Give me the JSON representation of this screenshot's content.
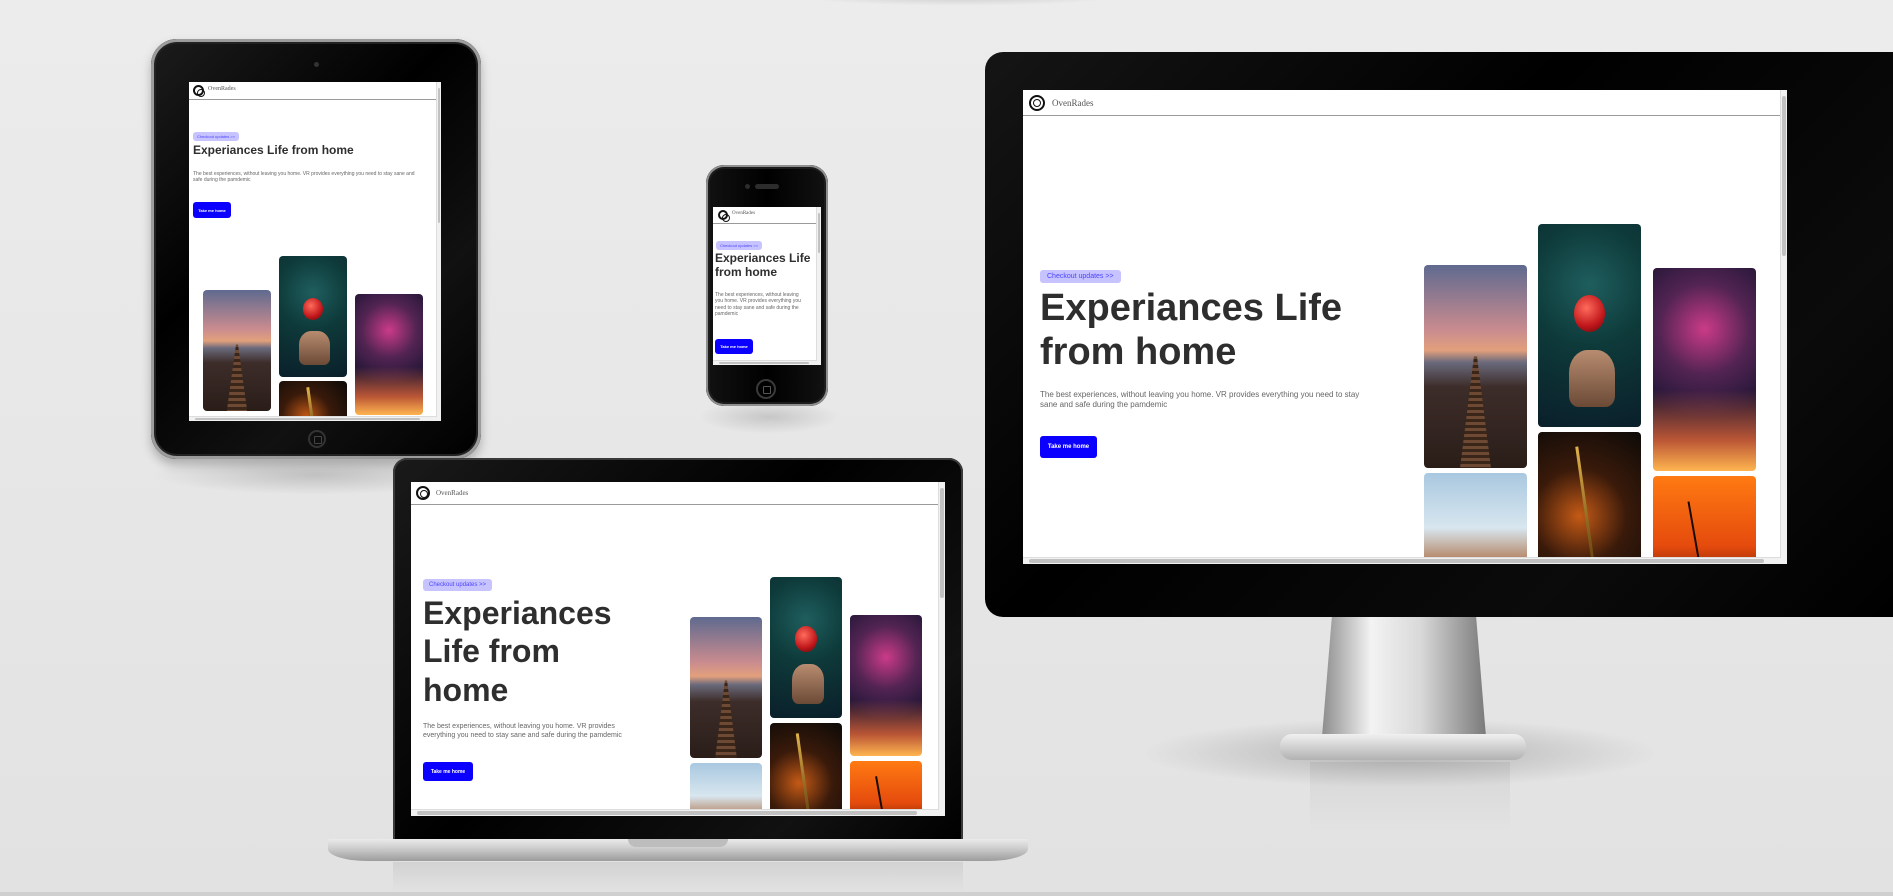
{
  "site": {
    "brand": "OvenRades",
    "badge": "Checkout updates >>",
    "title": "Experiances Life from home",
    "subtitle": "The best experiences, without leaving you home. VR provides everything you need to stay sane and safe during the pamdemic",
    "cta": "Take me home"
  },
  "devices": [
    "tablet",
    "phone",
    "laptop",
    "monitor"
  ],
  "colors": {
    "accent": "#0b00ff",
    "badge_bg": "#c7c3ff",
    "badge_text": "#4b44ff",
    "heading": "#2e2e2e"
  },
  "gallery_images": [
    "pier-sunset",
    "apple-hand",
    "fireworks",
    "sky-ride",
    "light-plants",
    "orange-wheat"
  ]
}
